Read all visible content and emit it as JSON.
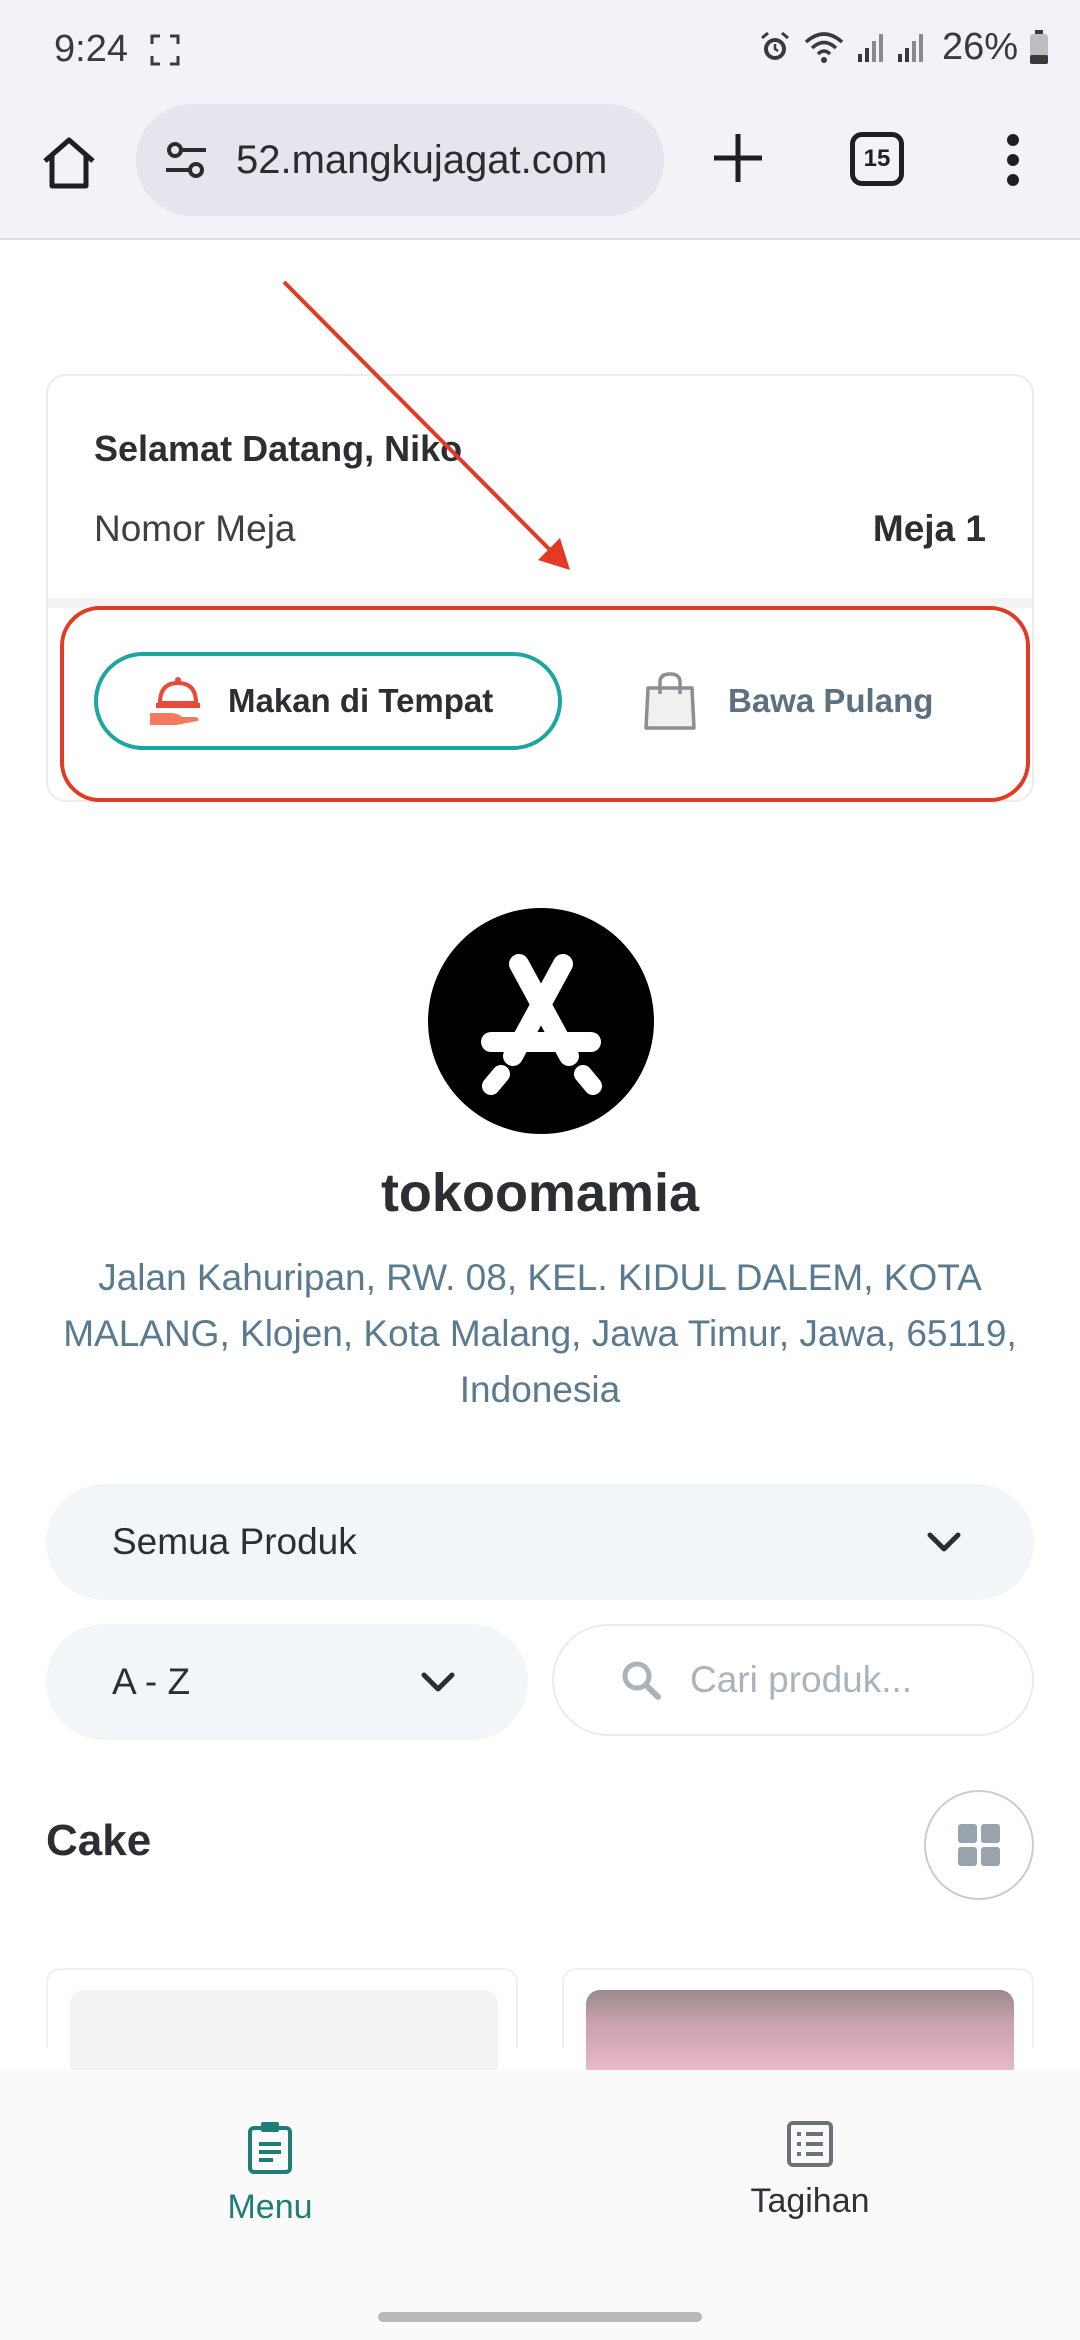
{
  "status_bar": {
    "time": "9:24",
    "battery": "26%"
  },
  "browser": {
    "url": "52.mangkujagat.com",
    "tab_count": "15"
  },
  "welcome": {
    "greeting": "Selamat Datang, Niko",
    "table_label": "Nomor Meja",
    "table_value": "Meja 1"
  },
  "order_mode": {
    "dine_in": "Makan di Tempat",
    "takeaway": "Bawa Pulang",
    "selected": "dine_in",
    "accent_color": "#1aa6a1",
    "highlight_color": "#e23a25"
  },
  "store": {
    "name": "tokoomamia",
    "address": "Jalan Kahuripan, RW. 08, KEL. KIDUL DALEM, KOTA MALANG, Klojen, Kota Malang, Jawa Timur, Jawa, 65119, Indonesia"
  },
  "filters": {
    "category": "Semua Produk",
    "sort": "A - Z",
    "search_placeholder": "Cari produk..."
  },
  "section": {
    "title": "Cake"
  },
  "bottom_nav": {
    "menu": "Menu",
    "bill": "Tagihan",
    "active": "menu",
    "active_color": "#1f7d78"
  }
}
